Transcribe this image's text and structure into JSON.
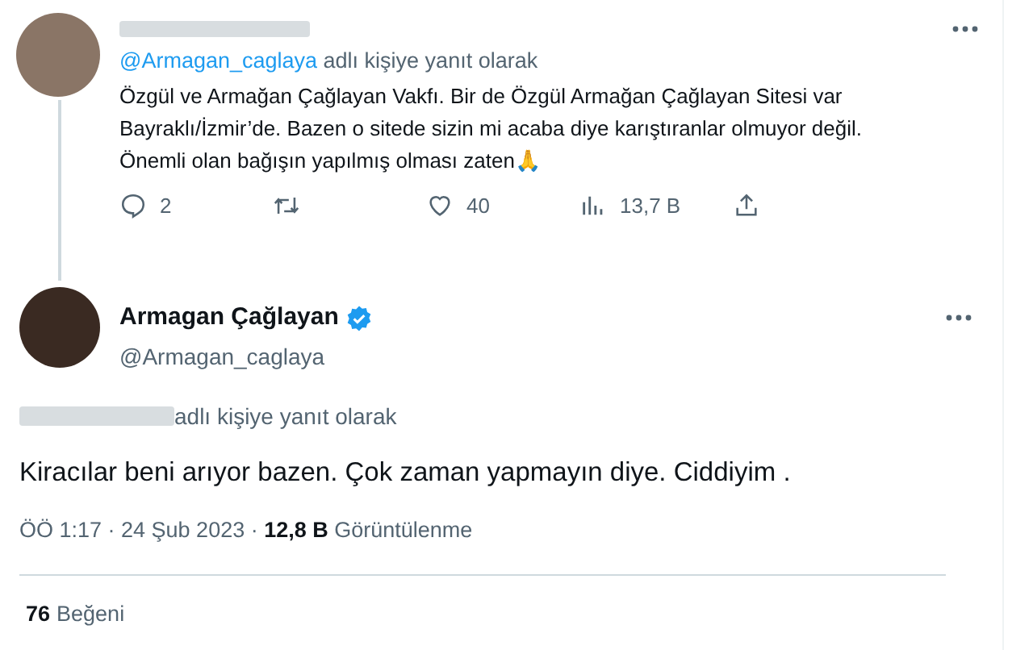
{
  "reply_tweet": {
    "reply_to": {
      "handle": "@Armagan_caglaya",
      "suffix": "adlı kişiye yanıt olarak"
    },
    "text": "Özgül ve Armağan Çağlayan Vakfı. Bir de Özgül Armağan Çağlayan Sitesi var Bayraklı/İzmir’de. Bazen o sitede sizin mi acaba diye karıştıranlar olmuyor değil. Önemli olan bağışın yapılmış olması zaten🙏",
    "actions": [
      {
        "kind": "reply",
        "count": "2"
      },
      {
        "kind": "retweet"
      },
      {
        "kind": "like",
        "count": "40"
      },
      {
        "kind": "views",
        "count": "13,7 B"
      },
      {
        "kind": "share"
      }
    ]
  },
  "main_tweet": {
    "name": "Armagan Çağlayan",
    "verified": true,
    "handle": "@Armagan_caglaya",
    "reply_to_suffix": "adlı kişiye yanıt olarak",
    "text": "Kiracılar beni arıyor bazen. Çok zaman yapmayın diye. Ciddiyim .",
    "time": "ÖÖ 1:17 · 24 Şub 2023 · ",
    "views": "12,8 B",
    "views_label": "Görüntülenme",
    "likes": {
      "count": "76",
      "label": "Beğeni"
    }
  }
}
